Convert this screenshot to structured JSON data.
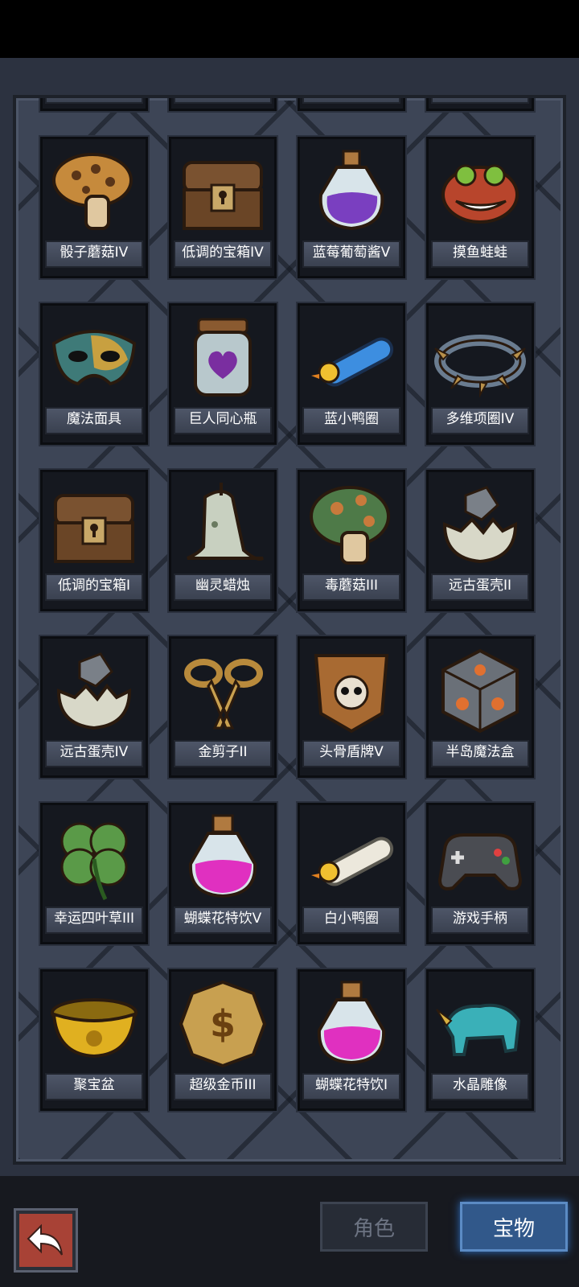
{
  "items": [
    {
      "name": "骰子蘑菇IV",
      "icon": "dice-mushroom-icon"
    },
    {
      "name": "低调的宝箱IV",
      "icon": "treasure-chest-icon"
    },
    {
      "name": "蓝莓葡萄酱V",
      "icon": "purple-potion-icon"
    },
    {
      "name": "摸鱼蛙蛙",
      "icon": "red-frog-icon"
    },
    {
      "name": "魔法面具",
      "icon": "magic-mask-icon"
    },
    {
      "name": "巨人同心瓶",
      "icon": "heart-jar-icon"
    },
    {
      "name": "蓝小鸭圈",
      "icon": "blue-duck-ring-icon"
    },
    {
      "name": "多维项圈IV",
      "icon": "spiked-collar-icon"
    },
    {
      "name": "低调的宝箱I",
      "icon": "treasure-chest-icon"
    },
    {
      "name": "幽灵蜡烛",
      "icon": "ghost-candle-icon"
    },
    {
      "name": "毒蘑菇III",
      "icon": "poison-mushroom-icon"
    },
    {
      "name": "远古蛋壳II",
      "icon": "eggshell-icon"
    },
    {
      "name": "远古蛋壳IV",
      "icon": "eggshell-icon"
    },
    {
      "name": "金剪子II",
      "icon": "golden-scissors-icon"
    },
    {
      "name": "头骨盾牌V",
      "icon": "skull-shield-icon"
    },
    {
      "name": "半岛魔法盒",
      "icon": "magic-cube-icon"
    },
    {
      "name": "幸运四叶草III",
      "icon": "four-leaf-clover-icon"
    },
    {
      "name": "蝴蝶花特饮V",
      "icon": "pink-potion-icon"
    },
    {
      "name": "白小鸭圈",
      "icon": "white-duck-ring-icon"
    },
    {
      "name": "游戏手柄",
      "icon": "gamepad-icon"
    },
    {
      "name": "聚宝盆",
      "icon": "treasure-bowl-icon"
    },
    {
      "name": "超级金币III",
      "icon": "gold-coin-icon"
    },
    {
      "name": "蝴蝶花特饮I",
      "icon": "pink-potion-icon"
    },
    {
      "name": "水晶雕像",
      "icon": "crystal-rhino-icon"
    }
  ],
  "tabs": {
    "role": "角色",
    "treasure": "宝物"
  },
  "colors": {
    "accent_tab": "#31588a",
    "back_button": "#a84236",
    "panel": "#3d4556"
  }
}
